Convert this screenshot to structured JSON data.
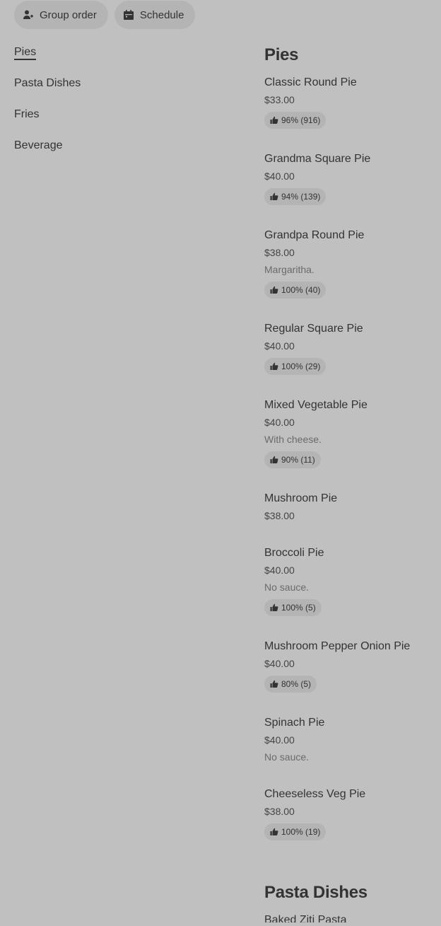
{
  "topbar": {
    "group_order": "Group order",
    "schedule": "Schedule"
  },
  "sidebar": {
    "items": [
      {
        "label": "Pies",
        "active": true
      },
      {
        "label": "Pasta Dishes"
      },
      {
        "label": "Fries"
      },
      {
        "label": "Beverage"
      }
    ]
  },
  "menu": {
    "sections": [
      {
        "title": "Pies",
        "items": [
          {
            "name": "Classic Round Pie",
            "price": "$33.00",
            "desc": "",
            "rating": "96% (916)"
          },
          {
            "name": "Grandma Square Pie",
            "price": "$40.00",
            "desc": "",
            "rating": "94% (139)"
          },
          {
            "name": "Grandpa Round Pie",
            "price": "$38.00",
            "desc": "Margaritha.",
            "rating": "100% (40)"
          },
          {
            "name": "Regular Square Pie",
            "price": "$40.00",
            "desc": "",
            "rating": "100% (29)"
          },
          {
            "name": "Mixed Vegetable Pie",
            "price": "$40.00",
            "desc": "With cheese.",
            "rating": "90% (11)"
          },
          {
            "name": "Mushroom Pie",
            "price": "$38.00",
            "desc": "",
            "rating": ""
          },
          {
            "name": "Broccoli Pie",
            "price": "$40.00",
            "desc": "No sauce.",
            "rating": "100% (5)"
          },
          {
            "name": "Mushroom Pepper Onion Pie",
            "price": "$40.00",
            "desc": "",
            "rating": "80% (5)"
          },
          {
            "name": "Spinach Pie",
            "price": "$40.00",
            "desc": "No sauce.",
            "rating": ""
          },
          {
            "name": "Cheeseless Veg Pie",
            "price": "$38.00",
            "desc": "",
            "rating": "100% (19)"
          }
        ]
      },
      {
        "title": "Pasta Dishes",
        "items": [
          {
            "name": "Baked Ziti Pasta"
          }
        ]
      }
    ]
  }
}
